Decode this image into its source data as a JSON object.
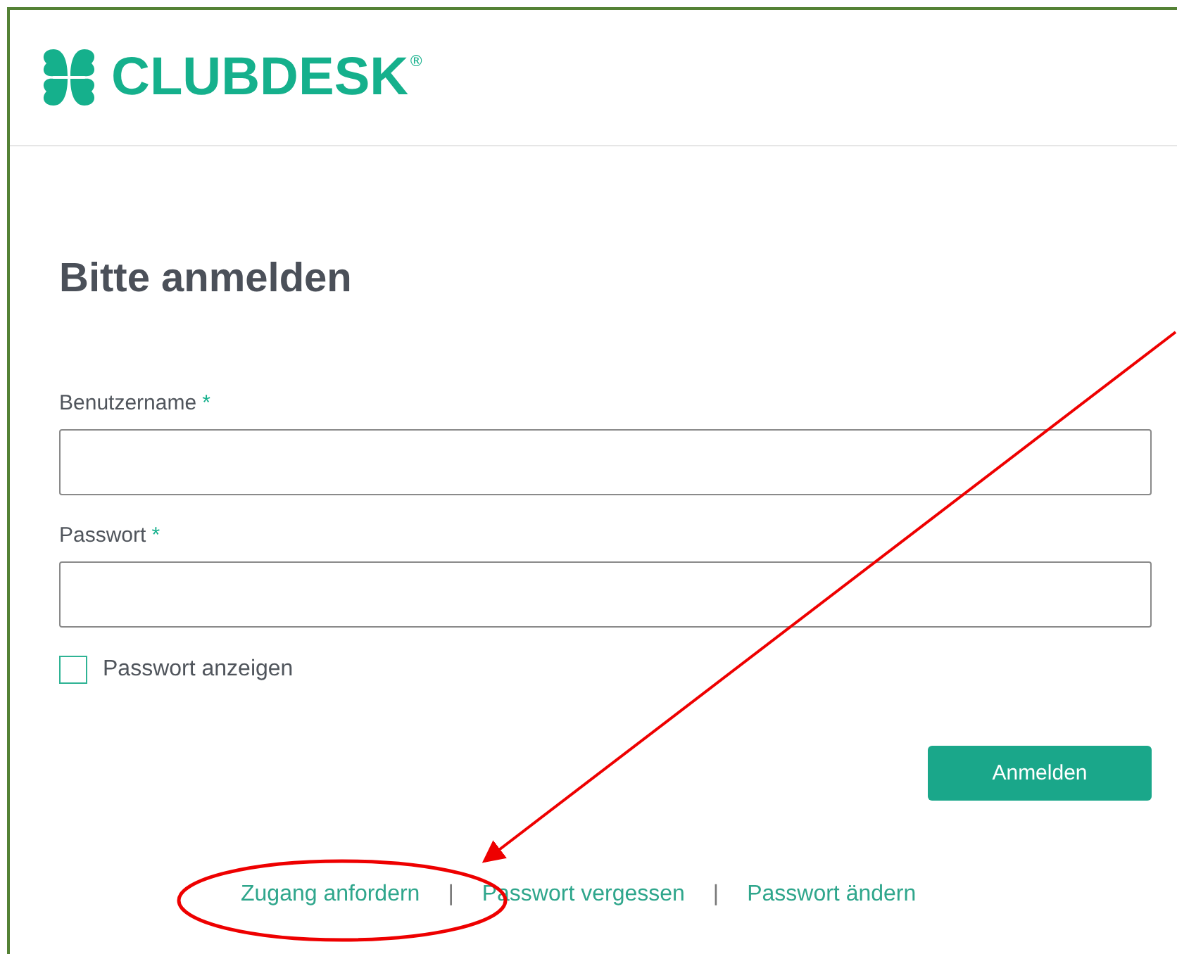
{
  "logo": {
    "name": "CLUBDESK",
    "mark": "®"
  },
  "title": "Bitte anmelden",
  "fields": [
    {
      "label": "Benutzername",
      "required_mark": "*"
    },
    {
      "label": "Passwort",
      "required_mark": "*"
    }
  ],
  "show_password": {
    "label": "Passwort anzeigen",
    "checked": false
  },
  "submit": "Anmelden",
  "links": [
    {
      "kind": "link",
      "text": "Zugang anfordern"
    },
    {
      "kind": "separator",
      "text": "|"
    },
    {
      "kind": "link",
      "text": "Passwort vergessen"
    },
    {
      "kind": "separator",
      "text": "|"
    },
    {
      "kind": "link",
      "text": "Passwort ändern"
    }
  ]
}
